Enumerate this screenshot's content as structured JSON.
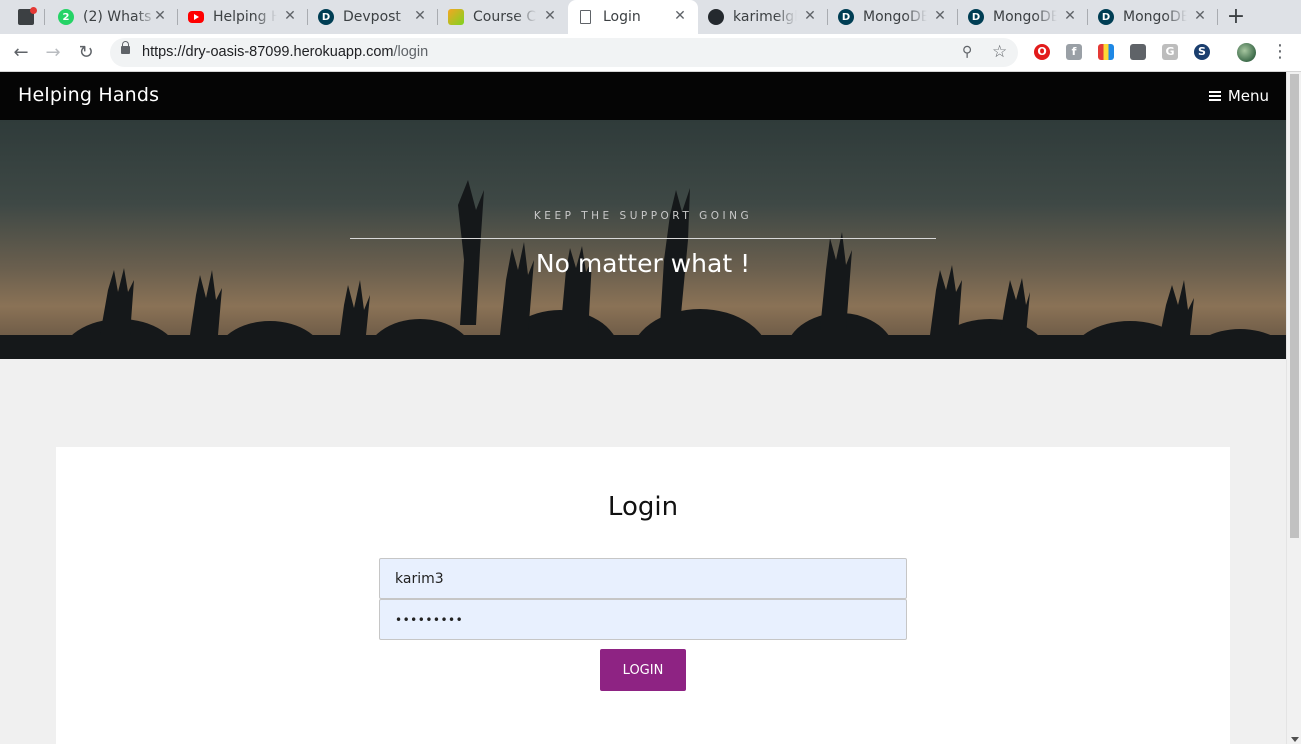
{
  "browser": {
    "tabs": [
      {
        "title": "",
        "favicon": "notification-app-icon",
        "color": "#3c4043"
      },
      {
        "title": "(2) Whats",
        "favicon": "whatsapp-icon",
        "color": "#25d366",
        "badge": "2"
      },
      {
        "title": "Helping H",
        "favicon": "youtube-icon",
        "color": "#ff0000"
      },
      {
        "title": "Devpost",
        "favicon": "devpost-icon",
        "color": "#003e54"
      },
      {
        "title": "Course Cc",
        "favicon": "course-icon",
        "color": "#f5a623"
      },
      {
        "title": "Login",
        "favicon": "page-icon",
        "color": "#5f6368"
      },
      {
        "title": "karimelgl",
        "favicon": "github-icon",
        "color": "#24292e"
      },
      {
        "title": "MongoDE",
        "favicon": "devpost-icon",
        "color": "#003e54"
      },
      {
        "title": "MongoDE",
        "favicon": "devpost-icon",
        "color": "#003e54"
      },
      {
        "title": "MongoDE",
        "favicon": "devpost-icon",
        "color": "#003e54"
      }
    ],
    "active_tab": 5,
    "close_glyph": "✕",
    "new_tab_glyph": "+",
    "url_host": "https://dry-oasis-87099.herokuapp.com",
    "url_path": "/login",
    "extensions": [
      "opera-icon",
      "facebook-icon",
      "color-picker-icon",
      "notes-icon",
      "grammarly-icon",
      "sync-icon"
    ]
  },
  "site": {
    "brand": "Helping Hands",
    "menu_label": "Menu",
    "hero": {
      "kicker": "KEEP THE SUPPORT GOING",
      "headline": "No matter what !"
    },
    "login": {
      "heading": "Login",
      "username_value": "karim3",
      "password_value": "•••••••••",
      "button_label": "LOGIN"
    }
  },
  "colors": {
    "navbar": "#050505",
    "button": "#8e2383",
    "autofill": "#e8f0fe"
  }
}
